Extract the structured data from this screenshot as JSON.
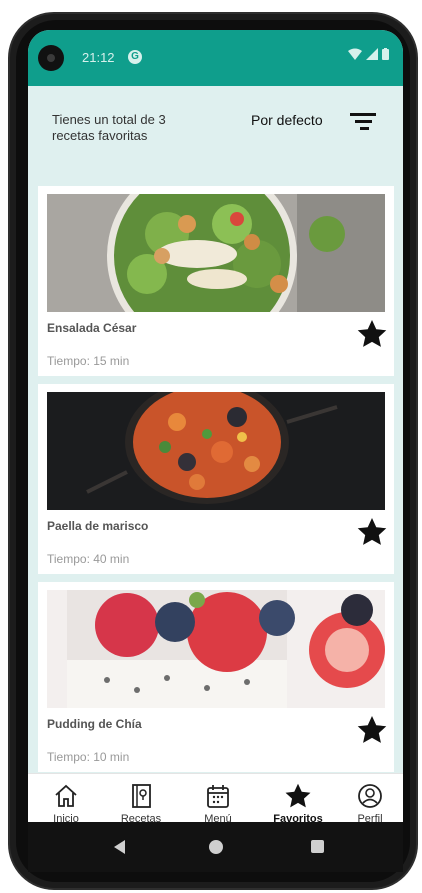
{
  "status_bar": {
    "time": "21:12",
    "notif_glyph": "G"
  },
  "header": {
    "total_text": "Tienes un total de 3 recetas favoritas",
    "sort_label": "Por defecto"
  },
  "recipes": [
    {
      "name": "Ensalada César",
      "time": "Tiempo: 15 min"
    },
    {
      "name": "Paella de marisco",
      "time": "Tiempo: 40 min"
    },
    {
      "name": "Pudding de Chía",
      "time": "Tiempo: 10 min"
    }
  ],
  "nav": [
    {
      "label": "Inicio",
      "icon": "home-icon"
    },
    {
      "label": "Recetas",
      "icon": "recipe-book-icon"
    },
    {
      "label": "Menú",
      "icon": "calendar-icon"
    },
    {
      "label": "Favoritos",
      "icon": "star-icon",
      "active": true
    },
    {
      "label": "Perfil",
      "icon": "profile-icon"
    }
  ],
  "colors": {
    "accent": "#0f9e8c",
    "background": "#dff0ef"
  }
}
